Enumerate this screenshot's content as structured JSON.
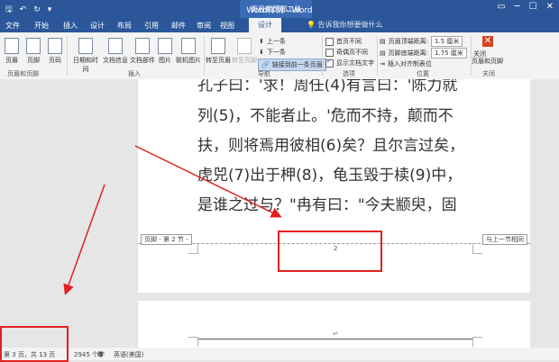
{
  "window": {
    "title": "Word样例 - Word",
    "context_tools": "页眉和页脚工具"
  },
  "tabs": [
    {
      "label": "文件"
    },
    {
      "label": "开始"
    },
    {
      "label": "插入"
    },
    {
      "label": "设计"
    },
    {
      "label": "布局"
    },
    {
      "label": "引用"
    },
    {
      "label": "邮件"
    },
    {
      "label": "审阅"
    },
    {
      "label": "视图"
    },
    {
      "label": "设计"
    }
  ],
  "tell_me": "告诉我你想要做什么",
  "ribbon": {
    "header_footer": {
      "header": "页眉",
      "footer": "页脚",
      "page_number": "页码",
      "group": "页眉和页脚"
    },
    "insert": {
      "date_time": "日期和时间",
      "doc_info": "文档信息",
      "doc_parts": "文档部件",
      "pictures": "图片",
      "online_pictures": "联机图片",
      "group": "插入"
    },
    "nav": {
      "goto_header": "转至页眉",
      "goto_footer": "转至页脚",
      "prev": "上一条",
      "next": "下一条",
      "link_prev": "链接到前一条页眉",
      "group": "导航"
    },
    "options": {
      "diff_first": "首页不同",
      "diff_odd_even": "奇偶页不同",
      "show_text": "显示文档文字",
      "group": "选项"
    },
    "position": {
      "header_top": "页眉顶端距离:",
      "header_top_val": "1.5 厘米",
      "footer_bottom": "页脚底端距离:",
      "footer_bottom_val": "1.75 厘米",
      "align_tab": "插入对齐制表位",
      "group": "位置"
    },
    "close": {
      "label_l1": "关闭",
      "label_l2": "页眉和页脚",
      "group": "关闭"
    }
  },
  "doc": {
    "lines": [
      "孔子曰：'求！周任(4)有言曰：'陈力就",
      "列(5)，不能者止。'危而不持，颠而不",
      "扶，则将焉用彼相(6)矣？且尔言过矣，",
      "虎兕(7)出于柙(8)，龟玉毁于椟(9)中，",
      "是谁之过与？\"冉有曰：\"今夫颛臾，固"
    ],
    "footer_label": "页脚 - 第 2 节 -",
    "same_as_prev": "与上一节相同",
    "page_number": "2"
  },
  "status": {
    "page": "第 3 页，共 13 页",
    "words": "2945 个字",
    "lang": "英语(美国)"
  }
}
